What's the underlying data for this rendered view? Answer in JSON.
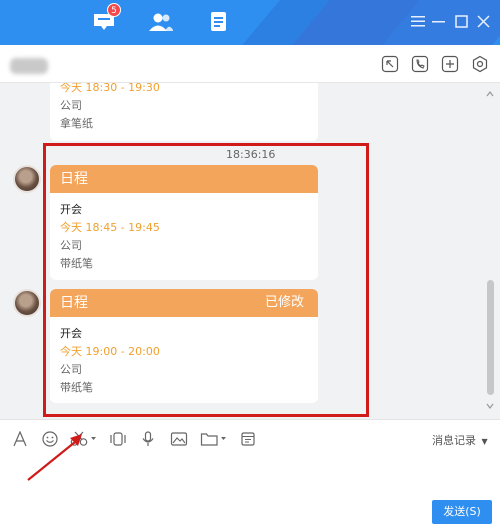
{
  "topbar": {
    "tabs": [
      {
        "name": "messages-icon",
        "badge": "5"
      },
      {
        "name": "contacts-icon"
      },
      {
        "name": "documents-icon"
      }
    ],
    "window_controls": [
      "menu-icon",
      "minimize-icon",
      "maximize-icon",
      "close-icon"
    ]
  },
  "chat": {
    "partial_card": {
      "time": "今天 18:30 - 19:30",
      "place": "公司",
      "bring": "拿笔纸"
    },
    "timestamp": "18:36:16",
    "cards": [
      {
        "header": "日程",
        "modified": "",
        "title": "开会",
        "time": "今天 18:45 - 19:45",
        "place": "公司",
        "bring": "带纸笔"
      },
      {
        "header": "日程",
        "modified": "已修改",
        "title": "开会",
        "time": "今天 19:00 - 20:00",
        "place": "公司",
        "bring": "带纸笔"
      }
    ]
  },
  "toolbar": {
    "history_label": "消息记录"
  },
  "send_button": "发送(S)",
  "colors": {
    "brand_blue": "#2f8ff0",
    "card_header": "#f4a55c",
    "time_text": "#f0a030",
    "highlight_red": "#d01b1b"
  }
}
